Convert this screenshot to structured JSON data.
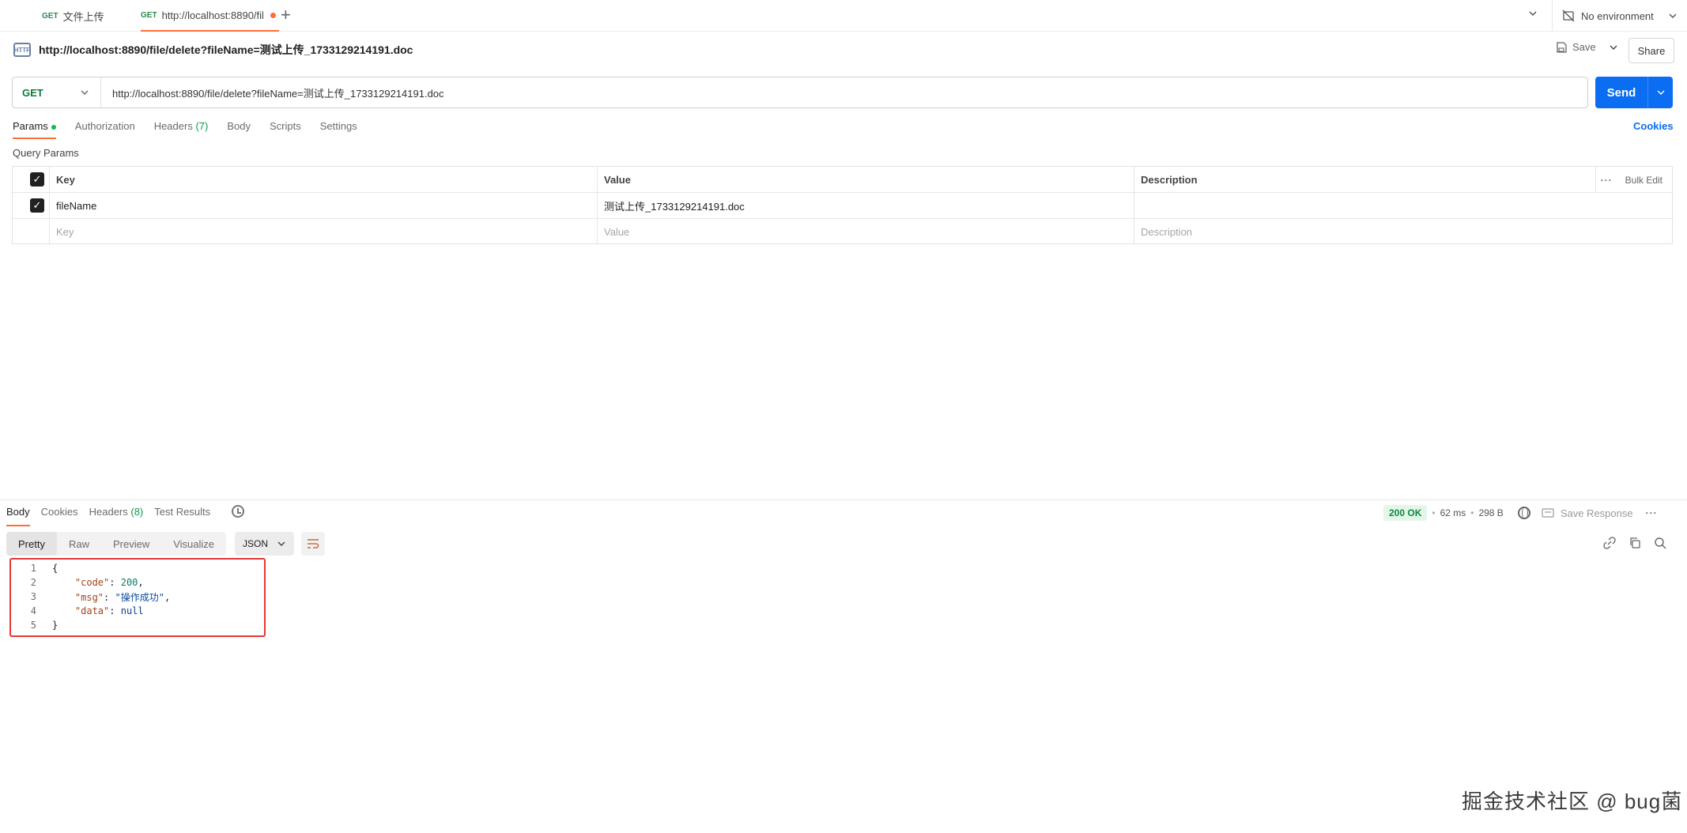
{
  "tabs": [
    {
      "method": "GET",
      "title": "文件上传"
    },
    {
      "method": "GET",
      "title": "http://localhost:8890/fil"
    }
  ],
  "environment": "No environment",
  "request": {
    "title": "http://localhost:8890/file/delete?fileName=测试上传_1733129214191.doc",
    "method": "GET",
    "url": "http://localhost:8890/file/delete?fileName=测试上传_1733129214191.doc",
    "save_label": "Save",
    "share_label": "Share",
    "send_label": "Send",
    "http_icon_text": "HTTP"
  },
  "request_tabs": {
    "params": "Params",
    "authorization": "Authorization",
    "headers": "Headers",
    "headers_count": "(7)",
    "body": "Body",
    "scripts": "Scripts",
    "settings": "Settings",
    "cookies": "Cookies"
  },
  "query_params": {
    "title": "Query Params",
    "headers": {
      "key": "Key",
      "value": "Value",
      "description": "Description",
      "bulk": "Bulk Edit"
    },
    "rows": [
      {
        "key": "fileName",
        "value": "测试上传_1733129214191.doc",
        "description": ""
      }
    ],
    "placeholders": {
      "key": "Key",
      "value": "Value",
      "description": "Description"
    }
  },
  "response": {
    "tabs": {
      "body": "Body",
      "cookies": "Cookies",
      "headers": "Headers",
      "headers_count": "(8)",
      "tests": "Test Results"
    },
    "status": "200 OK",
    "time": "62 ms",
    "size": "298 B",
    "save_response": "Save Response",
    "views": [
      "Pretty",
      "Raw",
      "Preview",
      "Visualize"
    ],
    "format": "JSON",
    "lines": [
      {
        "no": "1",
        "text": "{"
      },
      {
        "no": "2",
        "key": "\"code\"",
        "sep": ": ",
        "val": "200",
        "end": ","
      },
      {
        "no": "3",
        "key": "\"msg\"",
        "sep": ": ",
        "val": "\"操作成功\"",
        "end": ","
      },
      {
        "no": "4",
        "key": "\"data\"",
        "sep": ": ",
        "val": "null",
        "end": ""
      },
      {
        "no": "5",
        "text": "}"
      }
    ]
  },
  "watermark": "掘金技术社区 @ bug菌",
  "colors": {
    "accent": "#ff6c37",
    "send": "#0b6df1",
    "ok": "#0a8a3e",
    "highlight_box": "#e53935"
  }
}
